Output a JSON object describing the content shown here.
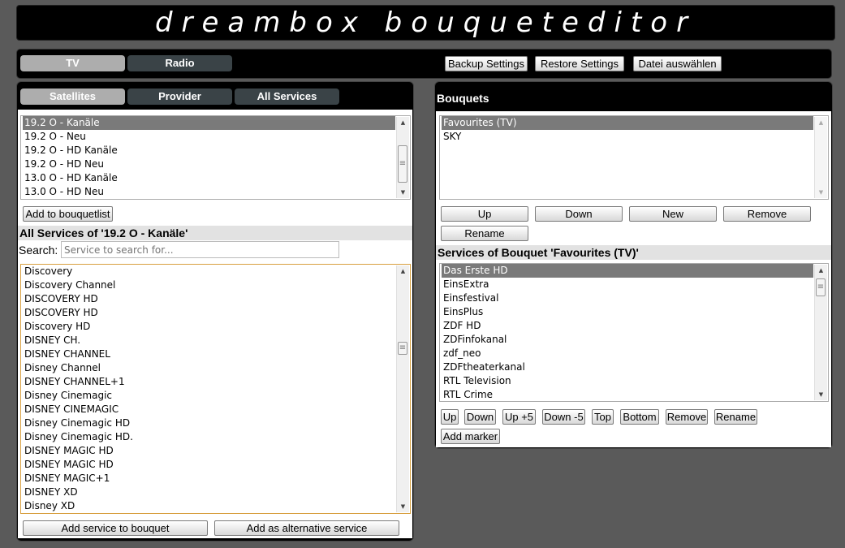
{
  "header": {
    "title": "dreambox bouqueteditor"
  },
  "topbar": {
    "tabs": [
      {
        "label": "TV",
        "active": true
      },
      {
        "label": "Radio",
        "active": false
      }
    ],
    "backup_label": "Backup Settings",
    "restore_label": "Restore Settings",
    "file_label": "Datei auswählen"
  },
  "left": {
    "tabs": [
      {
        "label": "Satellites",
        "active": true
      },
      {
        "label": "Provider",
        "active": false
      },
      {
        "label": "All Services",
        "active": false
      }
    ],
    "satellites": [
      "19.2 O - Kanäle",
      "19.2 O - Neu",
      "19.2 O - HD Kanäle",
      "19.2 O - HD Neu",
      "13.0 O - HD Kanäle",
      "13.0 O - HD Neu"
    ],
    "add_bouquetlist_label": "Add to bouquetlist",
    "services_heading": "All Services of '19.2 O - Kanäle'",
    "search_label": "Search:",
    "search_placeholder": "Service to search for...",
    "services": [
      "Discovery",
      "Discovery Channel",
      "DISCOVERY HD",
      "DISCOVERY HD",
      "Discovery HD",
      "DISNEY CH.",
      "DISNEY CHANNEL",
      "Disney Channel",
      "DISNEY CHANNEL+1",
      "Disney Cinemagic",
      "DISNEY CINEMAGIC",
      "Disney Cinemagic HD",
      "Disney Cinemagic HD.",
      "DISNEY MAGIC HD",
      "DISNEY MAGIC HD",
      "DISNEY MAGIC+1",
      "DISNEY XD",
      "Disney XD"
    ],
    "add_service_label": "Add service to bouquet",
    "add_alt_label": "Add as alternative service"
  },
  "right": {
    "bouquets_heading": "Bouquets",
    "bouquets": [
      "Favourites (TV)",
      "SKY"
    ],
    "bouquet_buttons": {
      "up": "Up",
      "down": "Down",
      "new": "New",
      "remove": "Remove",
      "rename": "Rename"
    },
    "bouquet_services_heading": "Services of Bouquet 'Favourites (TV)'",
    "bouquet_services": [
      "Das Erste HD",
      "EinsExtra",
      "Einsfestival",
      "EinsPlus",
      "ZDF HD",
      "ZDFinfokanal",
      "zdf_neo",
      "ZDFtheaterkanal",
      "RTL Television",
      "RTL Crime"
    ],
    "service_buttons": {
      "up": "Up",
      "down": "Down",
      "up5": "Up +5",
      "down5": "Down -5",
      "top": "Top",
      "bottom": "Bottom",
      "remove": "Remove",
      "rename": "Rename",
      "add_marker": "Add marker"
    }
  }
}
